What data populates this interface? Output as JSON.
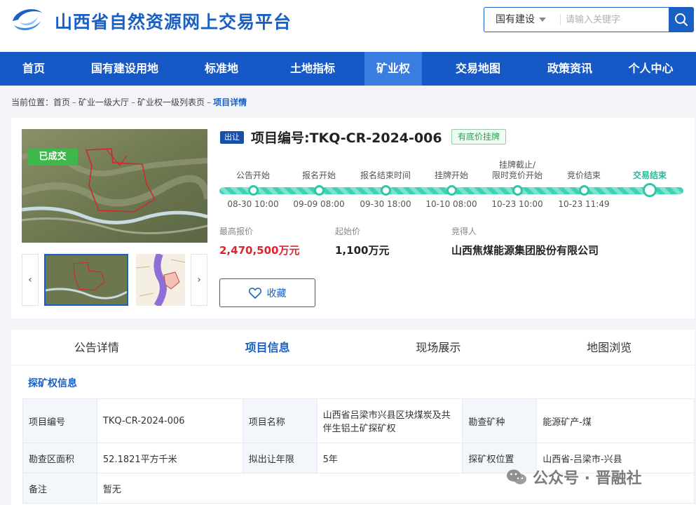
{
  "header": {
    "site_title": "山西省自然资源网上交易平台",
    "search_category": "国有建设",
    "search_placeholder": "请输入关键字"
  },
  "nav": {
    "items": [
      "首页",
      "国有建设用地",
      "标准地",
      "土地指标",
      "矿业权",
      "交易地图",
      "政策资讯",
      "个人中心"
    ],
    "active_index": 4
  },
  "breadcrumb": {
    "prefix": "当前位置：",
    "items": [
      "首页",
      "矿业一级大厅",
      "矿业权一级列表页"
    ],
    "separator": "–",
    "current": "项目详情"
  },
  "project": {
    "status_badge": "已成交",
    "type_tag": "出让",
    "number_label": "项目编号:TKQ-CR-2024-006",
    "reserve_tag": "有底价挂牌",
    "favorite_label": "收藏"
  },
  "timeline": [
    {
      "label": "公告开始",
      "time": "08-30 10:00"
    },
    {
      "label": "报名开始",
      "time": "09-09 08:00"
    },
    {
      "label": "报名结束时间",
      "time": "09-30 18:00"
    },
    {
      "label": "挂牌开始",
      "time": "10-10 08:00"
    },
    {
      "label": "挂牌截止/\n限时竞价开始",
      "time": "10-23 10:00"
    },
    {
      "label": "竞价结束",
      "time": "10-23 11:49"
    },
    {
      "label": "交易结束",
      "time": ""
    }
  ],
  "prices": {
    "highest_label": "最高报价",
    "highest_value": "2,470,500万元",
    "start_label": "起始价",
    "start_value": "1,100万元",
    "winner_label": "竞得人",
    "winner_value": "山西焦煤能源集团股份有限公司"
  },
  "tabs": {
    "items": [
      "公告详情",
      "项目信息",
      "现场展示",
      "地图浏览"
    ],
    "active_index": 1
  },
  "section_title": "探矿权信息",
  "info": {
    "row1": {
      "k1": "项目编号",
      "v1": "TKQ-CR-2024-006",
      "k2": "项目名称",
      "v2": "山西省吕梁市兴县区块煤炭及共伴生铝土矿探矿权",
      "k3": "勘查矿种",
      "v3": "能源矿产-煤"
    },
    "row2": {
      "k1": "勘查区面积",
      "v1": "52.1821平方千米",
      "k2": "拟出让年限",
      "v2": "5年",
      "k3": "探矿权位置",
      "v3": "山西省-吕梁市-兴县"
    },
    "row3": {
      "k1": "备注",
      "v1": "暂无"
    }
  },
  "watermark": "公众号 · 晋融社",
  "colors": {
    "brand_blue": "#1658c5",
    "accent_red": "#e0242f",
    "success_green": "#3eb84a",
    "timeline_teal": "#30c6a6"
  }
}
